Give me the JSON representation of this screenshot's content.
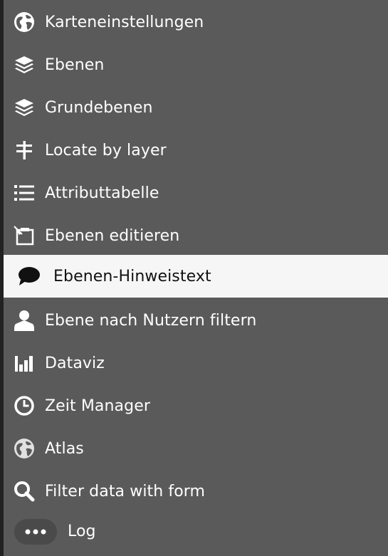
{
  "menu": {
    "items": [
      {
        "label": "Karteneinstellungen",
        "icon": "globe-icon"
      },
      {
        "label": "Ebenen",
        "icon": "layers-icon"
      },
      {
        "label": "Grundebenen",
        "icon": "layers-icon"
      },
      {
        "label": "Locate by layer",
        "icon": "signpost-icon"
      },
      {
        "label": "Attributtabelle",
        "icon": "list-icon"
      },
      {
        "label": "Ebenen editieren",
        "icon": "edit-icon"
      },
      {
        "label": "Ebenen-Hinweistext",
        "icon": "comment-icon",
        "active": true
      },
      {
        "label": "Ebene nach Nutzern filtern",
        "icon": "user-icon"
      },
      {
        "label": "Dataviz",
        "icon": "bar-chart-icon"
      },
      {
        "label": "Zeit Manager",
        "icon": "clock-icon"
      },
      {
        "label": "Atlas",
        "icon": "globe-icon"
      },
      {
        "label": "Filter data with form",
        "icon": "search-icon"
      },
      {
        "label": "Log",
        "icon": "ellipsis-icon"
      }
    ]
  },
  "colors": {
    "background": "#5a5a5a",
    "active_background": "#f6f6f6",
    "text": "#ffffff",
    "active_text": "#111111"
  }
}
